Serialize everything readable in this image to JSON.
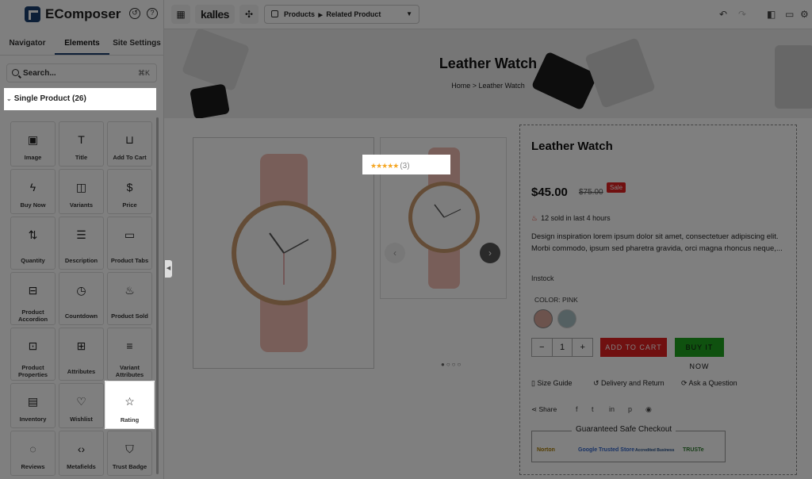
{
  "app": {
    "brand": "EComposer"
  },
  "tabs": [
    "Navigator",
    "Elements",
    "Site Settings"
  ],
  "search": {
    "placeholder": "Search...",
    "shortcut": "⌘K"
  },
  "group": {
    "label": "Single Product (26)"
  },
  "elements": [
    "Image",
    "Title",
    "Add To Cart",
    "Buy Now",
    "Variants",
    "Price",
    "Quantity",
    "Description",
    "Product Tabs",
    "Product Accordion",
    "Countdown",
    "Product Sold",
    "Product Properties",
    "Attributes",
    "Variant Attributes",
    "Inventory",
    "Wishlist",
    "Rating",
    "Reviews",
    "Metafields",
    "Trust Badge"
  ],
  "toolbar": {
    "theme": "kalles",
    "page_type": "Products",
    "page_name": "Related Product"
  },
  "hero": {
    "title": "Leather Watch",
    "crumb_home": "Home",
    "crumb_sep": ">",
    "crumb_current": "Leather Watch"
  },
  "product": {
    "title": "Leather Watch",
    "stars": "★★★★★",
    "review_count": "(3)",
    "price": "$45.00",
    "compare_price": "$75.00",
    "sale_badge": "Sale",
    "sold_text": "12 sold in last 4 hours",
    "description": "Design inspiration lorem ipsum dolor sit amet, consectetuer adipiscing elit. Morbi commodo, ipsum sed pharetra gravida, orci magna rhoncus neque,...",
    "stock": "Instock",
    "color_label": "COLOR: PINK",
    "colors": {
      "pink": "#d9a69a",
      "teal": "#a9c1c4"
    },
    "qty": "1",
    "qty_minus": "−",
    "qty_plus": "+",
    "add_to_cart": "ADD TO CART",
    "buy_now": "BUY IT NOW",
    "size_guide": "Size Guide",
    "delivery": "Delivery and Return",
    "ask": "Ask a Question",
    "share": "Share",
    "safe_checkout": "Guaranteed Safe Checkout",
    "badges": [
      "Norton",
      "Google Trusted Store",
      "Accredited Business",
      "TRUSTe"
    ]
  }
}
